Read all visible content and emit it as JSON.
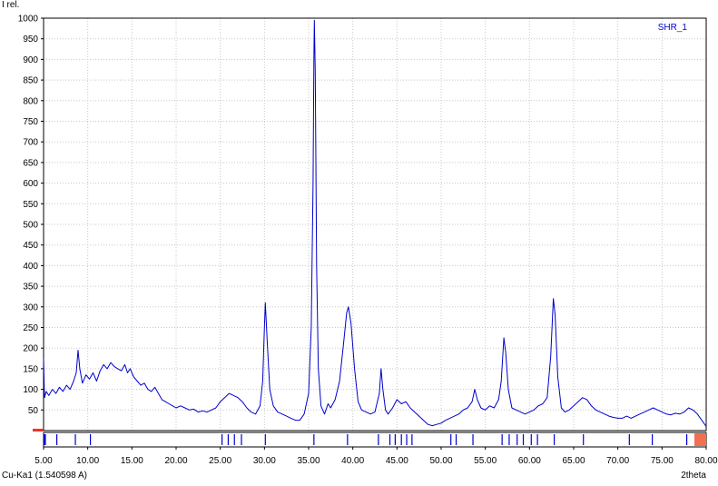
{
  "chart_data": {
    "type": "line",
    "ylabel": "I rel.",
    "xlabel": "2theta",
    "radiation_label": "Cu-Ka1 (1.540598 A)",
    "xlim": [
      5,
      80
    ],
    "ylim": [
      0,
      1000
    ],
    "xticks": [
      5,
      10,
      15,
      20,
      25,
      30,
      35,
      40,
      45,
      50,
      55,
      60,
      65,
      70,
      75,
      80
    ],
    "xtick_labels": [
      "5.00",
      "10.00",
      "15.00",
      "20.00",
      "25.00",
      "30.00",
      "35.00",
      "40.00",
      "45.00",
      "50.00",
      "55.00",
      "60.00",
      "65.00",
      "70.00",
      "75.00",
      "80.00"
    ],
    "yticks": [
      50,
      100,
      150,
      200,
      250,
      300,
      350,
      400,
      450,
      500,
      550,
      600,
      650,
      700,
      750,
      800,
      850,
      900,
      950,
      1000
    ],
    "ytick_labels": [
      "50",
      "100",
      "150",
      "200",
      "250",
      "300",
      "350",
      "400",
      "450",
      "500",
      "550",
      "600",
      "650",
      "700",
      "750",
      "800",
      "850",
      "900",
      "950",
      "1000"
    ],
    "grid": true,
    "legend": "top-right",
    "series": [
      {
        "name": "SHR_1",
        "color": "#0000cc",
        "points": [
          [
            5.0,
            175
          ],
          [
            5.1,
            80
          ],
          [
            5.3,
            95
          ],
          [
            5.6,
            85
          ],
          [
            6.0,
            100
          ],
          [
            6.4,
            90
          ],
          [
            6.8,
            105
          ],
          [
            7.2,
            95
          ],
          [
            7.6,
            110
          ],
          [
            8.0,
            100
          ],
          [
            8.4,
            120
          ],
          [
            8.7,
            140
          ],
          [
            8.9,
            195
          ],
          [
            9.1,
            150
          ],
          [
            9.4,
            115
          ],
          [
            9.8,
            135
          ],
          [
            10.2,
            125
          ],
          [
            10.6,
            140
          ],
          [
            11.0,
            120
          ],
          [
            11.4,
            145
          ],
          [
            11.8,
            160
          ],
          [
            12.2,
            150
          ],
          [
            12.6,
            165
          ],
          [
            13.0,
            155
          ],
          [
            13.4,
            150
          ],
          [
            13.8,
            145
          ],
          [
            14.2,
            160
          ],
          [
            14.5,
            140
          ],
          [
            14.8,
            150
          ],
          [
            15.2,
            130
          ],
          [
            15.6,
            120
          ],
          [
            16.0,
            110
          ],
          [
            16.4,
            115
          ],
          [
            16.8,
            100
          ],
          [
            17.2,
            95
          ],
          [
            17.6,
            105
          ],
          [
            18.0,
            90
          ],
          [
            18.4,
            75
          ],
          [
            18.8,
            70
          ],
          [
            19.2,
            65
          ],
          [
            19.6,
            60
          ],
          [
            20.0,
            55
          ],
          [
            20.5,
            60
          ],
          [
            21.0,
            55
          ],
          [
            21.5,
            50
          ],
          [
            22.0,
            52
          ],
          [
            22.5,
            45
          ],
          [
            23.0,
            48
          ],
          [
            23.5,
            45
          ],
          [
            24.0,
            50
          ],
          [
            24.5,
            55
          ],
          [
            25.0,
            70
          ],
          [
            25.5,
            80
          ],
          [
            26.0,
            90
          ],
          [
            26.5,
            85
          ],
          [
            27.0,
            80
          ],
          [
            27.5,
            70
          ],
          [
            28.0,
            55
          ],
          [
            28.5,
            45
          ],
          [
            29.0,
            40
          ],
          [
            29.5,
            60
          ],
          [
            29.8,
            120
          ],
          [
            30.0,
            250
          ],
          [
            30.1,
            310
          ],
          [
            30.3,
            220
          ],
          [
            30.6,
            100
          ],
          [
            31.0,
            60
          ],
          [
            31.5,
            45
          ],
          [
            32.0,
            40
          ],
          [
            32.5,
            35
          ],
          [
            33.0,
            30
          ],
          [
            33.5,
            25
          ],
          [
            34.0,
            25
          ],
          [
            34.5,
            40
          ],
          [
            35.0,
            90
          ],
          [
            35.3,
            250
          ],
          [
            35.5,
            600
          ],
          [
            35.6,
            900
          ],
          [
            35.65,
            995
          ],
          [
            35.75,
            870
          ],
          [
            35.9,
            400
          ],
          [
            36.1,
            150
          ],
          [
            36.4,
            60
          ],
          [
            36.8,
            40
          ],
          [
            37.2,
            65
          ],
          [
            37.5,
            55
          ],
          [
            38.0,
            75
          ],
          [
            38.5,
            120
          ],
          [
            39.0,
            220
          ],
          [
            39.3,
            285
          ],
          [
            39.5,
            300
          ],
          [
            39.8,
            260
          ],
          [
            40.2,
            150
          ],
          [
            40.6,
            70
          ],
          [
            41.0,
            50
          ],
          [
            41.5,
            45
          ],
          [
            42.0,
            40
          ],
          [
            42.5,
            45
          ],
          [
            43.0,
            90
          ],
          [
            43.2,
            150
          ],
          [
            43.4,
            100
          ],
          [
            43.7,
            50
          ],
          [
            44.0,
            40
          ],
          [
            44.5,
            55
          ],
          [
            45.0,
            75
          ],
          [
            45.5,
            65
          ],
          [
            46.0,
            70
          ],
          [
            46.5,
            55
          ],
          [
            47.0,
            45
          ],
          [
            47.5,
            35
          ],
          [
            48.0,
            25
          ],
          [
            48.5,
            15
          ],
          [
            49.0,
            12
          ],
          [
            49.5,
            15
          ],
          [
            50.0,
            18
          ],
          [
            50.5,
            25
          ],
          [
            51.0,
            30
          ],
          [
            51.5,
            35
          ],
          [
            52.0,
            40
          ],
          [
            52.5,
            50
          ],
          [
            53.0,
            55
          ],
          [
            53.5,
            70
          ],
          [
            53.8,
            100
          ],
          [
            54.1,
            75
          ],
          [
            54.5,
            55
          ],
          [
            55.0,
            50
          ],
          [
            55.5,
            60
          ],
          [
            56.0,
            55
          ],
          [
            56.5,
            75
          ],
          [
            56.8,
            120
          ],
          [
            57.1,
            225
          ],
          [
            57.3,
            190
          ],
          [
            57.6,
            100
          ],
          [
            58.0,
            55
          ],
          [
            58.5,
            50
          ],
          [
            59.0,
            45
          ],
          [
            59.5,
            40
          ],
          [
            60.0,
            45
          ],
          [
            60.5,
            50
          ],
          [
            61.0,
            60
          ],
          [
            61.5,
            65
          ],
          [
            62.0,
            80
          ],
          [
            62.4,
            180
          ],
          [
            62.7,
            320
          ],
          [
            62.9,
            280
          ],
          [
            63.2,
            130
          ],
          [
            63.6,
            55
          ],
          [
            64.0,
            45
          ],
          [
            64.5,
            50
          ],
          [
            65.0,
            60
          ],
          [
            65.5,
            70
          ],
          [
            66.0,
            80
          ],
          [
            66.5,
            75
          ],
          [
            67.0,
            60
          ],
          [
            67.5,
            50
          ],
          [
            68.0,
            45
          ],
          [
            68.5,
            40
          ],
          [
            69.0,
            35
          ],
          [
            69.5,
            32
          ],
          [
            70.0,
            30
          ],
          [
            70.5,
            30
          ],
          [
            71.0,
            35
          ],
          [
            71.5,
            30
          ],
          [
            72.0,
            35
          ],
          [
            72.5,
            40
          ],
          [
            73.0,
            45
          ],
          [
            73.5,
            50
          ],
          [
            74.0,
            55
          ],
          [
            74.5,
            50
          ],
          [
            75.0,
            45
          ],
          [
            75.5,
            40
          ],
          [
            76.0,
            38
          ],
          [
            76.5,
            42
          ],
          [
            77.0,
            40
          ],
          [
            77.5,
            45
          ],
          [
            78.0,
            55
          ],
          [
            78.5,
            50
          ],
          [
            79.0,
            40
          ],
          [
            79.5,
            25
          ],
          [
            80.0,
            10
          ]
        ]
      }
    ],
    "reference_lines": {
      "color": "#0000cc",
      "positions": [
        5.05,
        5.1,
        5.15,
        5.2,
        6.5,
        8.6,
        10.3,
        25.2,
        25.9,
        26.6,
        27.4,
        30.1,
        35.6,
        39.4,
        42.9,
        44.2,
        44.8,
        45.5,
        46.1,
        46.7,
        51.1,
        51.7,
        53.6,
        56.9,
        57.7,
        58.6,
        59.3,
        60.2,
        60.9,
        62.8,
        66.1,
        71.3,
        73.9,
        77.8
      ]
    },
    "marker_color": "#ee3322",
    "highlight_color": "#f07050"
  }
}
